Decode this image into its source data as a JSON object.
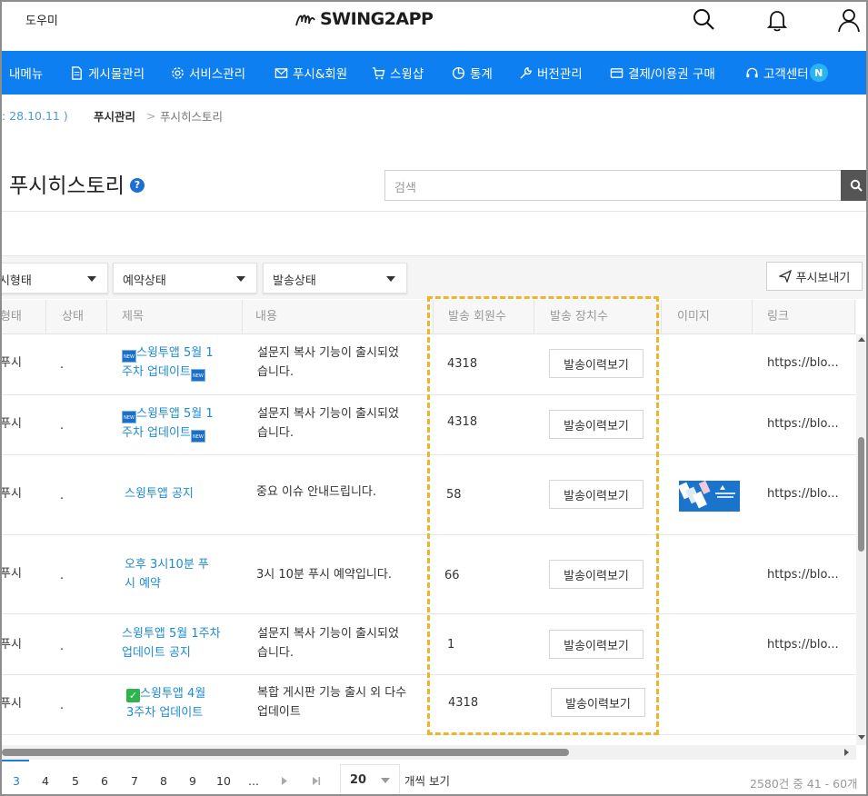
{
  "header": {
    "help_link": "도우미",
    "logo_text": "SWING2APP",
    "icons": [
      "search-icon",
      "bell-icon",
      "user-icon"
    ]
  },
  "nav": {
    "items": [
      {
        "label": "내메뉴",
        "icon": "menu-icon"
      },
      {
        "label": "게시물관리",
        "icon": "document-icon"
      },
      {
        "label": "서비스관리",
        "icon": "gear-icon"
      },
      {
        "label": "푸시&회원",
        "icon": "mail-icon"
      },
      {
        "label": "스윙샵",
        "icon": "cart-icon"
      },
      {
        "label": "통계",
        "icon": "pie-chart-icon"
      },
      {
        "label": "버전관리",
        "icon": "wrench-icon"
      },
      {
        "label": "결제/이용권 구매",
        "icon": "card-icon"
      },
      {
        "label": "고객센터",
        "icon": "headset-icon"
      }
    ],
    "badge": "N",
    "color": "#0e7ff0"
  },
  "breadcrumb": {
    "date": ": 28.10.11 )",
    "parent": "푸시관리",
    "separator": ">",
    "current": "푸시히스토리"
  },
  "page": {
    "title": "푸시히스토리",
    "help_icon": "?",
    "search_placeholder": "검색"
  },
  "filters": {
    "type_select": "푸시형태",
    "reservation_select": "예약상태",
    "send_select": "발송상태",
    "push_button": "푸시보내기"
  },
  "table": {
    "columns": [
      "푸시형태",
      "상태",
      "제목",
      "내용",
      "발송 회원수",
      "발송 장치수",
      "이미지",
      "링크"
    ],
    "rows": [
      {
        "type": "푸시",
        "status": ".",
        "title_line1": "스윙투앱 5월 1",
        "title_line2": "주차 업데이트",
        "content_line1": "설문지 복사 기능이 출시되었",
        "content_line2": "습니다.",
        "members": "4318",
        "button": "발송이력보기",
        "link": "https://blo..."
      },
      {
        "type": "푸시",
        "status": ".",
        "title_line1": "스윙투앱 5월 1",
        "title_line2": "주차 업데이트",
        "content_line1": "설문지 복사 기능이 출시되었",
        "content_line2": "습니다.",
        "members": "4318",
        "button": "발송이력보기",
        "link": "https://blo..."
      },
      {
        "type": "푸시",
        "status": ".",
        "title_line1": "스윙투앱 공지",
        "title_line2": "",
        "content_line1": "중요 이슈 안내드립니다.",
        "content_line2": "",
        "members": "58",
        "button": "발송이력보기",
        "link": "https://blo..."
      },
      {
        "type": "푸시",
        "status": ".",
        "title_line1": "오후 3시10분 푸",
        "title_line2": "시 예약",
        "content_line1": "3시 10분 푸시 예약입니다.",
        "content_line2": "",
        "members": "66",
        "button": "발송이력보기",
        "link": "https://blo..."
      },
      {
        "type": "푸시",
        "status": ".",
        "title_line1": "스윙투앱 5월 1주차",
        "title_line2": "업데이트 공지",
        "content_line1": "설문지 복사 기능이 출시되었",
        "content_line2": "습니다.",
        "members": "1",
        "button": "발송이력보기",
        "link": "https://blo..."
      },
      {
        "type": "푸시",
        "status": ".",
        "title_line1": "스윙투앱 4월",
        "title_line2": "3주차 업데이트",
        "content_line1": "복합 게시판 기능 출시 외 다수",
        "content_line2": "업데이트",
        "members": "4318",
        "button": "발송이력보기",
        "link": ""
      }
    ]
  },
  "pagination": {
    "pages": [
      "3",
      "4",
      "5",
      "6",
      "7",
      "8",
      "9",
      "10",
      "..."
    ],
    "active": "3",
    "page_size": "20",
    "page_size_suffix": "개씩 보기",
    "summary": "2580건 중 41 - 60개"
  },
  "colors": {
    "accent": "#0e7ff0",
    "highlight_border": "#f0b429",
    "link": "#1d8ad3"
  }
}
